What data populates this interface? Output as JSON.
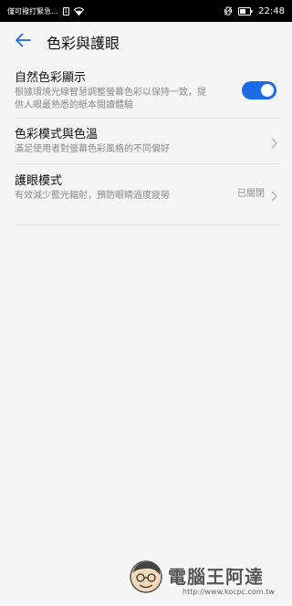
{
  "status_bar": {
    "carrier_text": "僅可撥打緊急...",
    "sim_label": "1",
    "time": "22:48",
    "icons": [
      "sim-icon",
      "wifi-icon",
      "vibrate-icon",
      "battery-icon"
    ]
  },
  "app_bar": {
    "title": "色彩與護眼",
    "back_icon": "arrow-left-icon"
  },
  "settings": [
    {
      "title": "自然色彩顯示",
      "description": "根據環境光線智慧調整螢幕色彩以保持一致，提供人眼最熟悉的紙本閱讀體驗",
      "control": "toggle",
      "toggle_on": true
    },
    {
      "title": "色彩模式與色溫",
      "description": "滿足使用者對螢幕色彩風格的不同偏好",
      "control": "chevron"
    },
    {
      "title": "護眼模式",
      "description": "有效減少藍光輻射，預防眼睛過度疲勞",
      "value": "已關閉",
      "control": "chevron"
    }
  ],
  "watermark": {
    "brand": "電腦王阿達",
    "url": "http://www.kocpc.com.tw"
  },
  "colors": {
    "accent": "#1e6be6",
    "background": "#f5f5f5",
    "status_bar": "#000000"
  }
}
